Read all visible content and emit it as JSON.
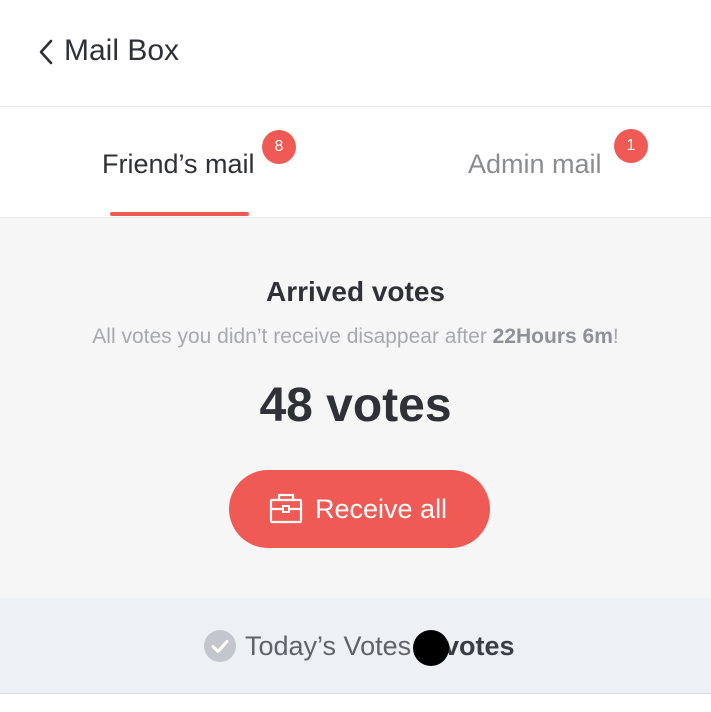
{
  "header": {
    "title": "Mail Box",
    "back_icon": "chevron-left-icon"
  },
  "tabs": [
    {
      "label": "Friend’s mail",
      "badge": "8",
      "active": true
    },
    {
      "label": "Admin mail",
      "badge": "1",
      "active": false
    }
  ],
  "votes": {
    "title": "Arrived votes",
    "subtitle_prefix": "All votes you didn’t receive disappear after ",
    "subtitle_time": "22Hours 6m",
    "subtitle_suffix": "!",
    "count": "48 votes",
    "button_label": "Receive all",
    "button_icon": "briefcase-icon"
  },
  "today": {
    "label": "Today’s Votes",
    "value": "votes",
    "icon": "check-circle-icon"
  },
  "colors": {
    "accent": "#f05a55",
    "text_primary": "#2f3137",
    "text_muted": "#a7a9ad",
    "panel_bg": "#f6f6f7",
    "today_bg": "#edf0f5"
  }
}
